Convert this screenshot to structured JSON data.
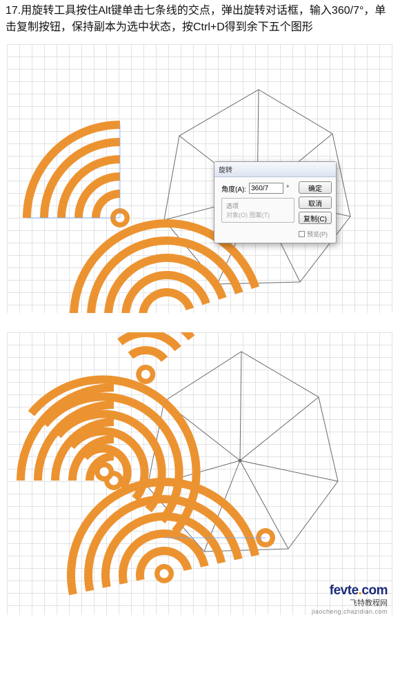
{
  "instruction": {
    "step_number": "17.",
    "text": "用旋转工具按住Alt键单击七条线的交点，弹出旋转对话框，输入360/7°，单击复制按钮，保持副本为选中状态，按Ctrl+D得到余下五个图形"
  },
  "dialog": {
    "title": "旋转",
    "angle_label": "角度(A):",
    "angle_value": "360/7",
    "degree": "°",
    "options_label": "选项",
    "options_text": "对象(O)   图案(T)",
    "preview_label": "预览(P)",
    "buttons": {
      "ok": "确定",
      "cancel": "取消",
      "copy": "复制(C)"
    }
  },
  "watermark": {
    "brand_left": "fevte",
    "brand_dot": ".",
    "brand_right": "com",
    "line2": "飞特教程网",
    "line3": "jiaocheng.chazidian.com"
  },
  "colors": {
    "arc_orange": "#ec9331",
    "grid_light": "#e2e2e2",
    "heptagon_stroke": "#6a6a6a",
    "watermark_blue": "#1b2a78"
  }
}
